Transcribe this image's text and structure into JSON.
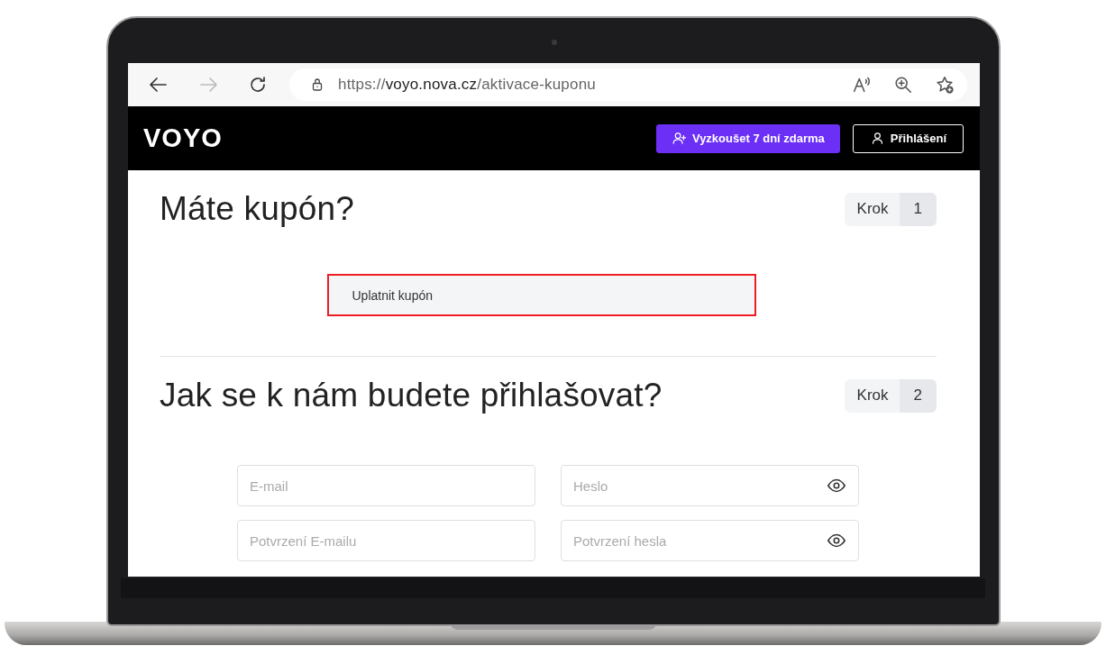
{
  "browser": {
    "url": {
      "scheme": "https://",
      "host": "voyo.nova.cz",
      "path": "/aktivace-kuponu"
    },
    "forward_disabled": true
  },
  "header": {
    "logo": "VOYO",
    "buttons": [
      {
        "kind": "primary",
        "label": "Vyzkoušet 7 dní zdarma"
      },
      {
        "kind": "outline",
        "label": "Přihlášení"
      }
    ]
  },
  "sections": [
    {
      "title": "Máte kupón?",
      "step_label": "Krok",
      "step": "1",
      "kind": "coupon",
      "coupon_button": {
        "label": "Uplatnit kupón",
        "highlighted": true
      }
    },
    {
      "title": "Jak se k nám budete přihlašovat?",
      "step_label": "Krok",
      "step": "2",
      "kind": "form",
      "fields": [
        {
          "placeholder": "E-mail",
          "kind": "text"
        },
        {
          "placeholder": "Heslo",
          "kind": "password"
        },
        {
          "placeholder": "Potvrzení E-mailu",
          "kind": "text"
        },
        {
          "placeholder": "Potvrzení hesla",
          "kind": "password"
        }
      ]
    }
  ]
}
